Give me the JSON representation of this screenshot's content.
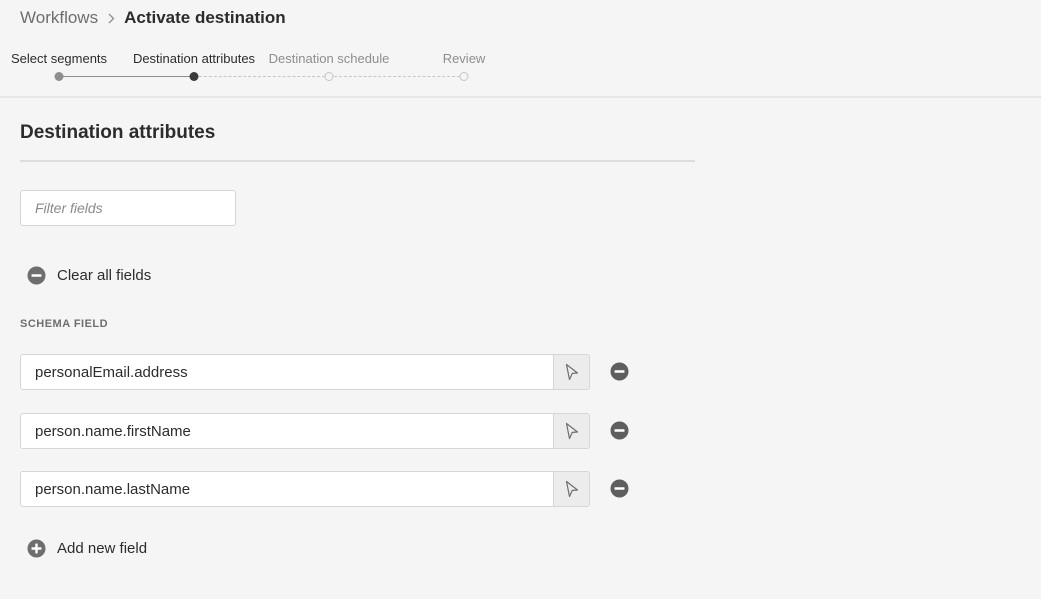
{
  "breadcrumb": {
    "parent": "Workflows",
    "current": "Activate destination",
    "separator_icon": "chevron-right-icon"
  },
  "stepper": {
    "steps": [
      {
        "label": "Select segments",
        "state": "done"
      },
      {
        "label": "Destination attributes",
        "state": "active"
      },
      {
        "label": "Destination schedule",
        "state": "todo"
      },
      {
        "label": "Review",
        "state": "todo"
      }
    ]
  },
  "section": {
    "title": "Destination attributes"
  },
  "filter": {
    "placeholder": "Filter fields",
    "value": ""
  },
  "actions": {
    "clear_all_label": "Clear all fields",
    "clear_all_icon": "remove-circle-icon",
    "add_new_label": "Add new field",
    "add_new_icon": "add-circle-icon"
  },
  "schema": {
    "header": "SCHEMA FIELD",
    "fields": [
      {
        "value": "personalEmail.address"
      },
      {
        "value": "person.name.firstName"
      },
      {
        "value": "person.name.lastName"
      }
    ],
    "picker_icon": "select-pointer-icon",
    "remove_icon": "remove-circle-icon"
  },
  "colors": {
    "background": "#f5f5f5",
    "text": "#2c2c2c",
    "muted": "#6e6e6e",
    "icon": "#6e6e6e"
  }
}
